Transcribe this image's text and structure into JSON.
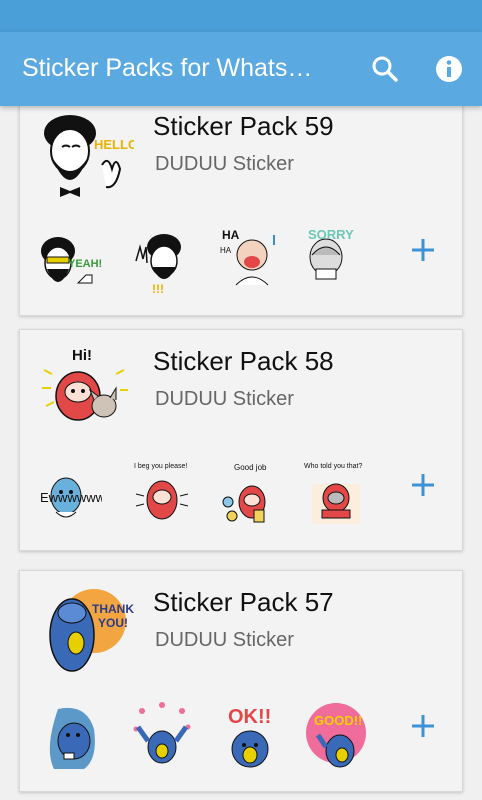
{
  "app_bar": {
    "title": "Sticker Packs for Whats…",
    "background": "#5aa9e0"
  },
  "icons": {
    "search": "search-icon",
    "info": "info-icon",
    "add": "plus-icon"
  },
  "packs": [
    {
      "name": "Sticker Pack 59",
      "author": "DUDUU Sticker",
      "tray_caption": "HELLO!",
      "stickers": [
        "YEAH!",
        "!!!",
        "HA",
        "SORRY"
      ]
    },
    {
      "name": "Sticker Pack 58",
      "author": "DUDUU Sticker",
      "tray_caption": "Hi!",
      "stickers": [
        "Ewwwwww",
        "I beg you please!",
        "Good job",
        "Who told you that?"
      ]
    },
    {
      "name": "Sticker Pack 57",
      "author": "DUDUU Sticker",
      "tray_caption": "THANK YOU!",
      "stickers": [
        "",
        "",
        "OK!!",
        "GOOD!!"
      ]
    }
  ]
}
